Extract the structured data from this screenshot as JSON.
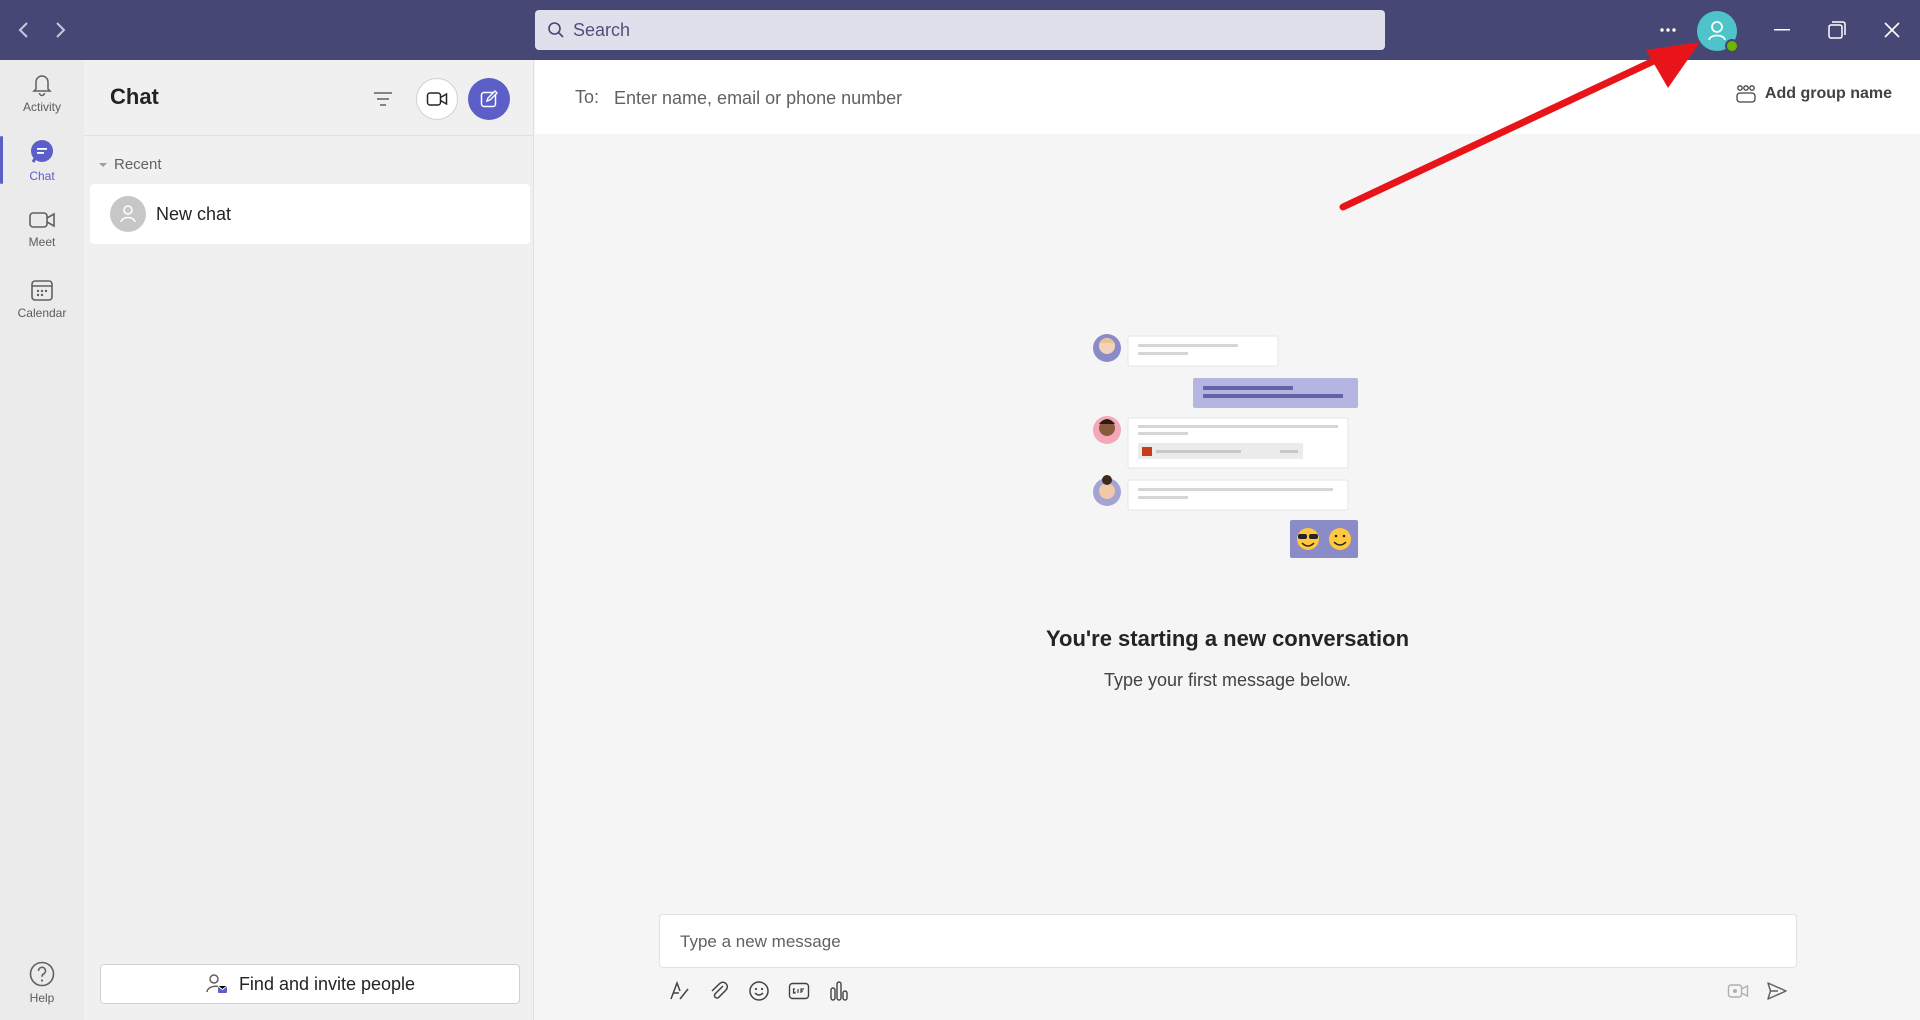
{
  "titlebar": {
    "search_placeholder": "Search"
  },
  "rail": {
    "items": [
      {
        "label": "Activity"
      },
      {
        "label": "Chat"
      },
      {
        "label": "Meet"
      },
      {
        "label": "Calendar"
      }
    ],
    "help_label": "Help"
  },
  "chatlist": {
    "title": "Chat",
    "section_label": "Recent",
    "items": [
      {
        "name": "New chat"
      }
    ],
    "invite_label": "Find and invite people"
  },
  "main": {
    "to_label": "To:",
    "to_placeholder": "Enter name, email or phone number",
    "group_name_label": "Add group name",
    "heading": "You're starting a new conversation",
    "subheading": "Type your first message below.",
    "compose_placeholder": "Type a new message"
  },
  "colors": {
    "titlebar": "#464775",
    "accent": "#5b5fc7",
    "avatar": "#4ec4c9",
    "presence": "#6bb700",
    "annotation_arrow": "#e8141a"
  }
}
